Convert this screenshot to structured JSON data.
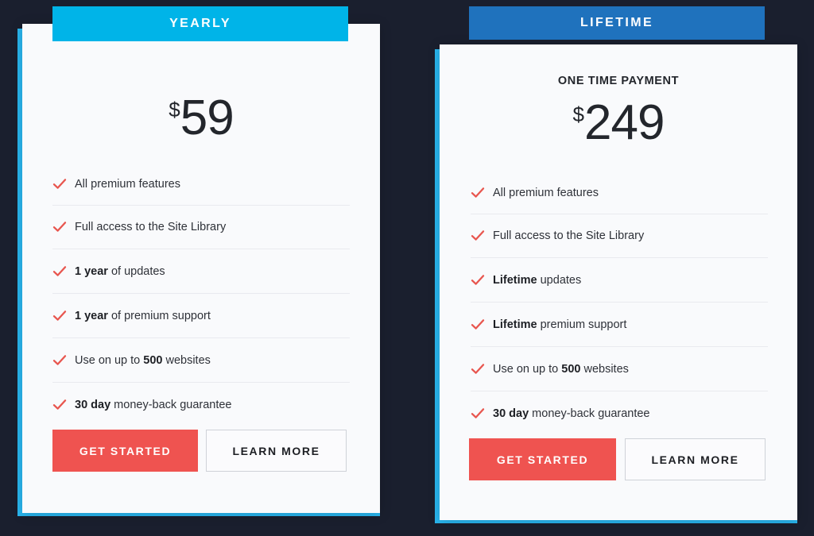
{
  "theme": {
    "page_background": "#1a1f2e",
    "card_background": "#f9fafc",
    "accent_cyan": "#29b6ef",
    "badge_yearly": "#00b4e8",
    "badge_lifetime": "#1f72bd",
    "check_color": "#e8564f",
    "primary_button": "#ef5350",
    "divider": "#e9eaef",
    "text_color": "#2e3138"
  },
  "plans": [
    {
      "id": "yearly",
      "badge_label": "YEARLY",
      "payment_note": "",
      "currency_symbol": "$",
      "price": "59",
      "features": [
        {
          "bold": "",
          "text": "All premium features",
          "bold_position": "none"
        },
        {
          "bold": "",
          "text": "Full access to the Site Library",
          "bold_position": "none"
        },
        {
          "bold": "1 year",
          "text": " of updates",
          "bold_position": "prefix"
        },
        {
          "bold": "1 year",
          "text": " of premium support",
          "bold_position": "prefix"
        },
        {
          "pre": "Use on up to ",
          "bold": "500",
          "text": " websites",
          "bold_position": "middle"
        },
        {
          "bold": "30 day",
          "text": " money-back guarantee",
          "bold_position": "prefix"
        }
      ],
      "primary_button": "GET STARTED",
      "secondary_button": "LEARN MORE"
    },
    {
      "id": "lifetime",
      "badge_label": "LIFETIME",
      "payment_note": "ONE TIME PAYMENT",
      "currency_symbol": "$",
      "price": "249",
      "features": [
        {
          "bold": "",
          "text": "All premium features",
          "bold_position": "none"
        },
        {
          "bold": "",
          "text": "Full access to the Site Library",
          "bold_position": "none"
        },
        {
          "bold": "Lifetime",
          "text": " updates",
          "bold_position": "prefix"
        },
        {
          "bold": "Lifetime",
          "text": " premium support",
          "bold_position": "prefix"
        },
        {
          "pre": "Use on up to ",
          "bold": "500",
          "text": " websites",
          "bold_position": "middle"
        },
        {
          "bold": "30 day",
          "text": " money-back guarantee",
          "bold_position": "prefix"
        }
      ],
      "primary_button": "GET STARTED",
      "secondary_button": "LEARN MORE"
    }
  ]
}
